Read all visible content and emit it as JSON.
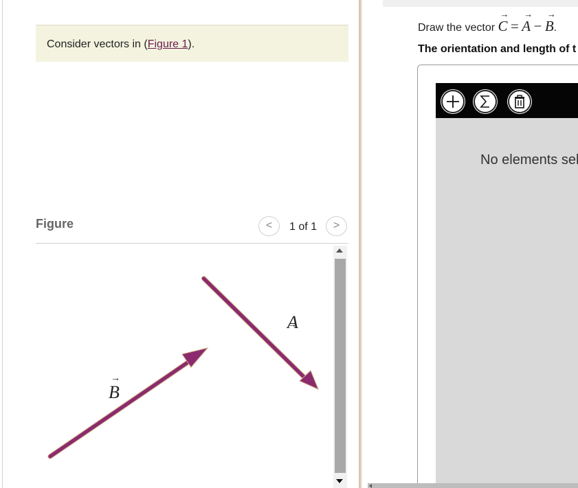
{
  "prompt": {
    "prefix": "Consider vectors in (",
    "link": "Figure 1",
    "suffix": ")."
  },
  "figure": {
    "heading": "Figure",
    "pager": "1 of 1",
    "prev_label": "<",
    "next_label": ">",
    "vector_a_label": "A",
    "vector_b_label": "B",
    "arrow_color": "#8b2a6e"
  },
  "question": {
    "prefix": "Draw the vector ",
    "c": "C",
    "equals": "=",
    "a": "A",
    "minus": "−",
    "b": "B",
    "end": "."
  },
  "instruction": "The orientation and length of t",
  "tools": {
    "add_icon": "plus-icon",
    "sum_icon": "sigma-icon",
    "delete_icon": "trash-icon"
  },
  "status": "No elements sele"
}
